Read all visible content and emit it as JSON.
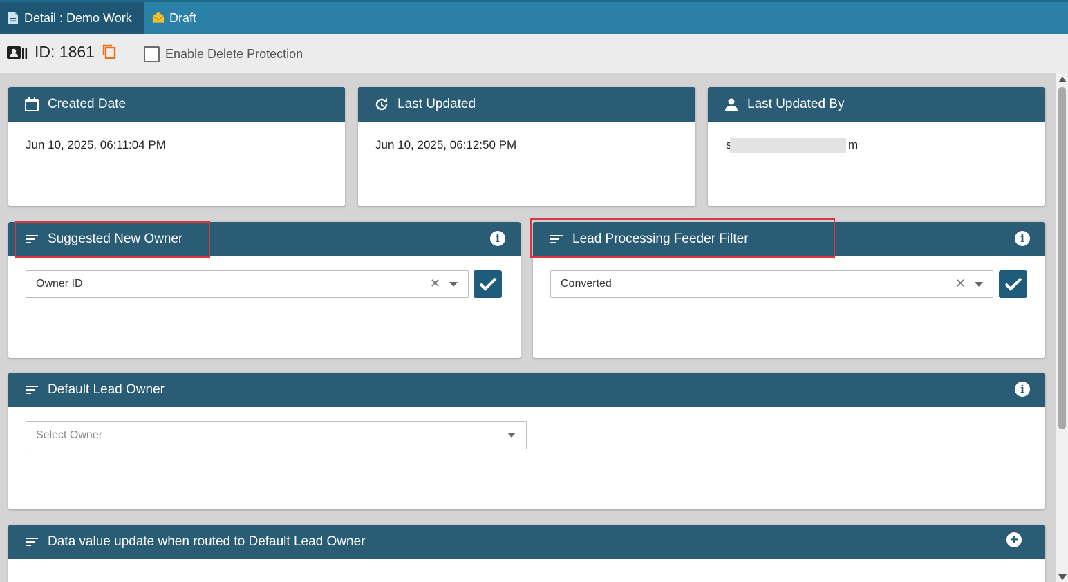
{
  "tabs": {
    "detail_label": "Detail : Demo Work",
    "draft_label": "Draft"
  },
  "record": {
    "id_label": "ID: 1861",
    "delete_protection_label": "Enable Delete Protection",
    "delete_protection_checked": false
  },
  "cards": {
    "created": {
      "title": "Created Date",
      "value": "Jun 10, 2025, 06:11:04 PM"
    },
    "updated": {
      "title": "Last Updated",
      "value": "Jun 10, 2025, 06:12:50 PM"
    },
    "updated_by": {
      "title": "Last Updated By",
      "value_start": "s",
      "value_end": "m"
    },
    "suggested_owner": {
      "title": "Suggested New Owner",
      "selected": "Owner ID"
    },
    "feeder_filter": {
      "title": "Lead Processing Feeder Filter",
      "selected": "Converted"
    },
    "default_owner": {
      "title": "Default Lead Owner",
      "placeholder": "Select Owner"
    },
    "data_update": {
      "title": "Data value update when routed to Default Lead Owner"
    }
  },
  "icons": {
    "detail_tab": "document-icon",
    "draft_tab": "envelope-icon",
    "id_badge": "id-card-icon",
    "copy": "copy-icon",
    "calendar": "calendar-icon",
    "refresh": "refresh-clock-icon",
    "user": "user-icon",
    "list": "sort-lines-icon",
    "info": "info-icon",
    "add": "plus-circle-icon",
    "check": "check-icon",
    "clear": "clear-x-icon",
    "dropdown": "chevron-down-icon"
  },
  "colors": {
    "tabbar": "#2a80a6",
    "active_tab": "#1e5673",
    "card_header": "#2a5c76",
    "highlight": "#d9363e",
    "copy_icon": "#e8711c",
    "draft_icon": "#f2c12e"
  }
}
